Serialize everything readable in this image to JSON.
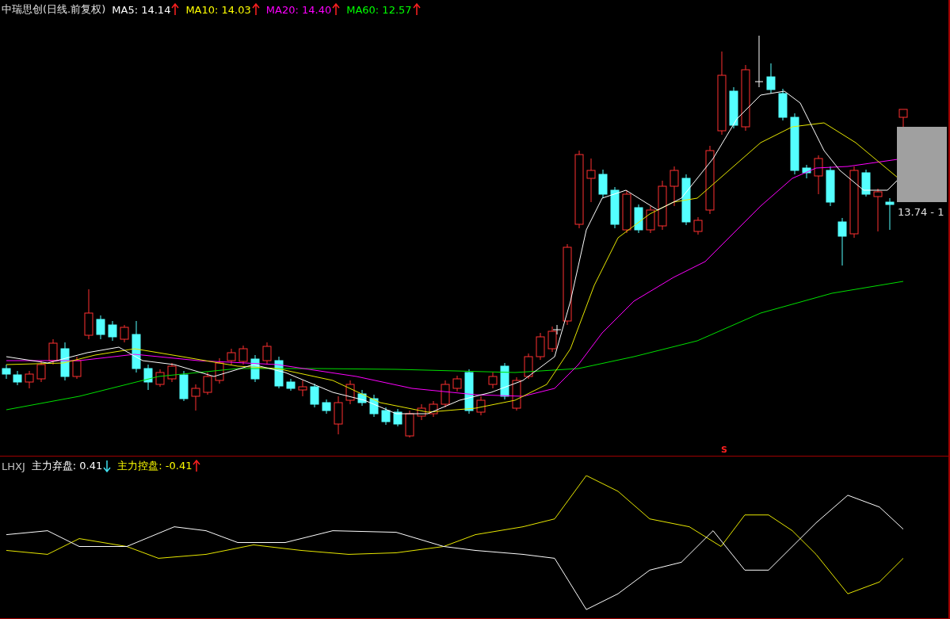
{
  "main_panel": {
    "title": "中瑞思创(日线.前复权)",
    "indicators": [
      {
        "label": "MA5:",
        "value": "14.14",
        "color": "#ffffff",
        "kind": "up"
      },
      {
        "label": "MA10:",
        "value": "14.03",
        "color": "#ffff00",
        "kind": "up"
      },
      {
        "label": "MA20:",
        "value": "14.40",
        "color": "#ff00ff",
        "kind": "up"
      },
      {
        "label": "MA60:",
        "value": "12.57",
        "color": "#00ff00",
        "kind": "up"
      }
    ],
    "price_label": "13.74 - 1",
    "signal_mark": "S"
  },
  "sub_panel": {
    "title": "LHXJ",
    "indicators": [
      {
        "label": "主力弃盘:",
        "value": "0.41",
        "color": "#ffffff",
        "kind": "down"
      },
      {
        "label": "主力控盘:",
        "value": "-0.41",
        "color": "#ffff00",
        "kind": "up"
      }
    ]
  }
}
